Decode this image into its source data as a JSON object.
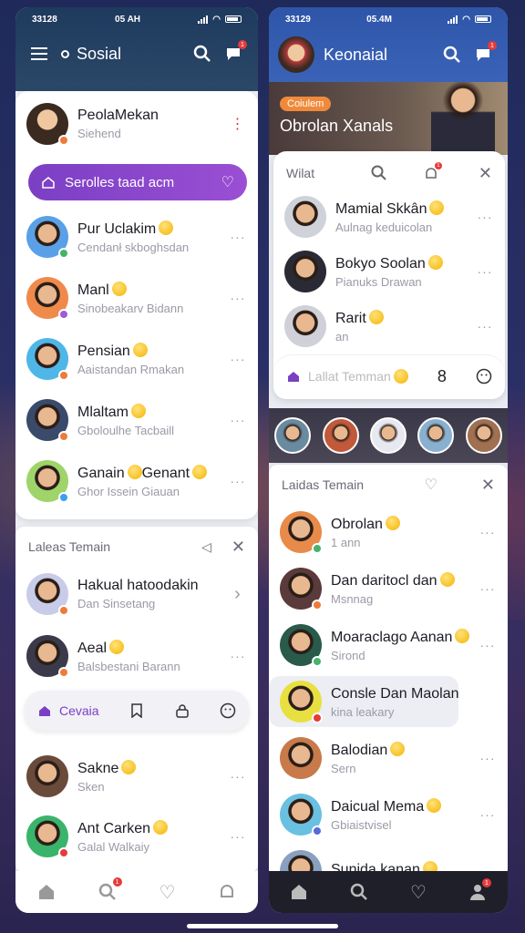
{
  "left": {
    "status": {
      "time": "33128",
      "carrier": "05 AH"
    },
    "app_title": "Sosial",
    "profile": {
      "name": "PeolaMekan",
      "sub": "Siehend"
    },
    "banner_button": "Serolles taad acm",
    "contacts": [
      {
        "name": "Pur Uclakim",
        "sub": "Cendanł skboghsdan",
        "color": "#5aa0e8",
        "dot": "#45b36b"
      },
      {
        "name": "Manl",
        "sub": "Sinobeakarv Bidann",
        "color": "#f08a4b",
        "dot": "#a05ad8"
      },
      {
        "name": "Pensian",
        "sub": "Aaistandan Rmakan",
        "color": "#4fb6e8",
        "dot": "#ee7b3a"
      },
      {
        "name": "Mlaltam",
        "sub": "Gboloulhe Tacbaill",
        "color": "#3a4a6a",
        "dot": "#ee7b3a"
      },
      {
        "name": "Ganain",
        "name2": "Genant",
        "sub": "Ghor Issein Giauan",
        "color": "#9fd46a",
        "dot": "#3aa0e8"
      }
    ],
    "section": {
      "title": "Laleas Temain"
    },
    "section_contacts": [
      {
        "name": "Hakual hatoodakin",
        "sub": "Dan Sinsetang",
        "color": "#c9cce8",
        "dot": "#ee7b3a"
      },
      {
        "name": "Aeal",
        "sub": "Balsbestani Barann",
        "color": "#3a3a4a",
        "dot": "#ee7b3a"
      }
    ],
    "action_pill": {
      "label": "Cevaia"
    },
    "more_contacts": [
      {
        "name": "Sakne",
        "sub": "Sken",
        "color": "#6a4a3a"
      },
      {
        "name": "Ant Carken",
        "sub": "Galal Walkaiy",
        "color": "#3ab46a",
        "dot": "#e63b3b"
      }
    ],
    "badges": {
      "chat": "1",
      "search": "1"
    }
  },
  "right": {
    "status": {
      "time": "33129",
      "carrier": "05.4M"
    },
    "app_title": "Keonaial",
    "hero": {
      "tag": "Coiulem",
      "title": "Obrolan Xanals"
    },
    "popup": {
      "search_placeholder": "Wilat",
      "footer_placeholder": "Lallat Temman",
      "count": "8"
    },
    "popup_contacts": [
      {
        "name": "Mamial Skkân",
        "sub": "Aulnag keduicolan",
        "color": "#d0d2da"
      },
      {
        "name": "Bokyo Soolan",
        "sub": "Pianuks Drawan",
        "color": "#2a2a34"
      },
      {
        "name": "Rarit",
        "sub": "an",
        "color": "#cfd0d8"
      }
    ],
    "section": {
      "title": "Laidas Temain"
    },
    "contacts": [
      {
        "name": "Obrolan",
        "sub": "1 ann",
        "color": "#e88a4a",
        "dot": "#45b36b"
      },
      {
        "name": "Dan daritocl dan",
        "sub": "Msnnag",
        "color": "#5a3a3a",
        "dot": "#ee7b3a"
      },
      {
        "name": "Moaraclago Aanan",
        "sub": "Sirond",
        "color": "#2a5a4a",
        "dot": "#45b36b"
      },
      {
        "name": "Consle Dan Maolan",
        "sub": "kina leakary",
        "color": "#e8e040",
        "dot": "#e63b3b"
      },
      {
        "name": "Balodian",
        "sub": "Sern",
        "color": "#c87a4a"
      },
      {
        "name": "Daicual Mema",
        "sub": "Gbiaistvisel",
        "color": "#6ac0e0",
        "dot": "#5a6ad8"
      },
      {
        "name": "Sunida kanan",
        "sub": "",
        "color": "#8aa0c0"
      }
    ],
    "badges": {
      "chat": "1",
      "popup_bell": "1",
      "profile": "1"
    }
  },
  "colors": {
    "purple": "#7b3fc4",
    "navy": "#1e3a5e",
    "blue": "#3a63b8"
  }
}
